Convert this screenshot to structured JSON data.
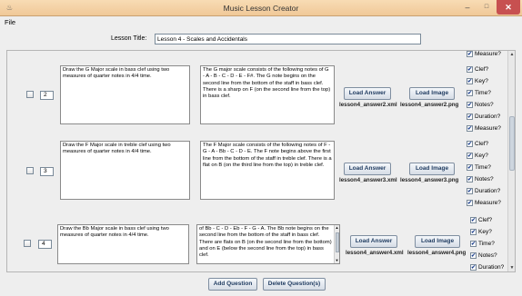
{
  "window": {
    "title": "Music Lesson Creator",
    "app_icon": "coffee-cup-icon",
    "minimize": "–",
    "maximize": "□",
    "close": "✕"
  },
  "menu": {
    "file": "File"
  },
  "lesson": {
    "label": "Lesson Title:",
    "value": "Lesson 4 - Scales and Accidentals"
  },
  "checks": {
    "measure": "Measure?",
    "clef": "Clef?",
    "key": "Key?",
    "time": "Time?",
    "notes": "Notes?",
    "duration": "Duration?",
    "checked_glyph": "✔"
  },
  "questions": [
    {
      "number": "2",
      "question": "Draw the G Major scale in bass clef using two measures of quarter notes in 4/4 time.",
      "answer": "The G major scale consists of the following notes of G - A - B - C - D - E - F#. The G note begins on the second line from the bottom of the staff in bass clef. There is a sharp on F (on the second line from the top) in bass clef.",
      "load_answer": "Load Answer",
      "load_image": "Load Image",
      "answer_file": "lesson4_answer2.xml",
      "image_file": "lesson4_answer2.png"
    },
    {
      "number": "3",
      "question": "Draw the F Major scale in treble clef using two measures of quarter notes in 4/4 time.",
      "answer": "The F Major scale consists of the following notes of F - G - A - Bb - C - D - E. The F note begins above the first line from the bottom of the staff in treble clef. There is a flat on B (on the third line from the top) in treble clef.",
      "load_answer": "Load Answer",
      "load_image": "Load Image",
      "answer_file": "lesson4_answer3.xml",
      "image_file": "lesson4_answer3.png"
    },
    {
      "number": "4",
      "question": "Draw the Bb Major scale in bass clef using two measures of quarter notes in 4/4 time.",
      "answer": "of Bb - C - D - Eb - F - G - A. The Bb note begins on the second line from the bottom of the staff in bass clef. There are flats on B (on the second line from the bottom) and on E (below the second line from the top) in bass clef.",
      "load_answer": "Load Answer",
      "load_image": "Load Image",
      "answer_file": "lesson4_answer4.xml",
      "image_file": "lesson4_answer4.png"
    }
  ],
  "footer": {
    "add": "Add Question",
    "delete": "Delete Question(s)"
  }
}
